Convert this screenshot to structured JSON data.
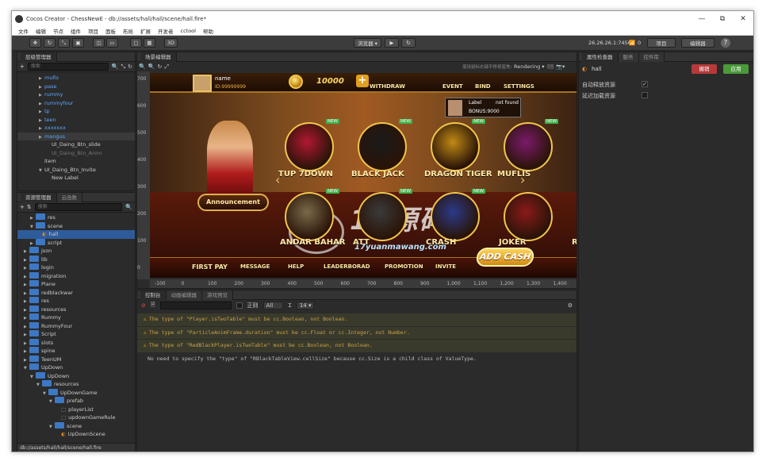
{
  "window": {
    "app": "Cocos Creator",
    "title": "Cocos Creator - ChessNewE - db://assets/hall/hall/scene/hall.fire*"
  },
  "window_controls": {
    "minimize": "—",
    "maximize": "⧉",
    "close": "✕"
  },
  "menu": [
    "文件",
    "编辑",
    "节点",
    "组件",
    "项目",
    "面板",
    "布局",
    "扩展",
    "开发者",
    "cctool",
    "帮助"
  ],
  "toolbar": {
    "btn_3d": "3D",
    "preview_select": "浏览器 ▾",
    "play": "▶",
    "refresh": "↻",
    "ip": "26.26.26.1:7456",
    "wifi_count": "0",
    "project_btn": "项目",
    "editor_btn": "编辑器",
    "help": "?"
  },
  "hierarchy": {
    "tab": "层级管理器",
    "search_placeholder": "搜索",
    "items": [
      {
        "label": "mufis",
        "indent": 3,
        "color": "blue"
      },
      {
        "label": "pase",
        "indent": 3,
        "color": "blue"
      },
      {
        "label": "rummy",
        "indent": 3,
        "color": "blue"
      },
      {
        "label": "rummyfour",
        "indent": 3,
        "color": "blue"
      },
      {
        "label": "tp",
        "indent": 3,
        "color": "blue"
      },
      {
        "label": "teen",
        "indent": 3,
        "color": "blue"
      },
      {
        "label": "xxxxxxx",
        "indent": 3,
        "color": "blue"
      },
      {
        "label": "mangus",
        "indent": 3,
        "color": "blue",
        "selected_bg": true
      },
      {
        "label": "UI_Daing_Btn_slide",
        "indent": 4,
        "color": "white"
      },
      {
        "label": "UI_Daing_Btn_Anim",
        "indent": 4,
        "color": "dim"
      },
      {
        "label": "item",
        "indent": 3,
        "color": "white"
      },
      {
        "label": "UI_Daing_Btn_Invite",
        "indent": 3,
        "color": "white",
        "expanded": true
      },
      {
        "label": "New Label",
        "indent": 4,
        "color": "white"
      }
    ]
  },
  "assets": {
    "tab": "资源管理器",
    "tab2": "云函数",
    "search_placeholder": "搜索",
    "items": [
      {
        "label": "res",
        "indent": 2,
        "type": "folder"
      },
      {
        "label": "scene",
        "indent": 2,
        "type": "folder",
        "expanded": true
      },
      {
        "label": "hall",
        "indent": 3,
        "type": "scene",
        "selected": true
      },
      {
        "label": "script",
        "indent": 2,
        "type": "folder"
      },
      {
        "label": "json",
        "indent": 1,
        "type": "folder"
      },
      {
        "label": "lib",
        "indent": 1,
        "type": "folder"
      },
      {
        "label": "login",
        "indent": 1,
        "type": "folder"
      },
      {
        "label": "migration",
        "indent": 1,
        "type": "folder"
      },
      {
        "label": "Plane",
        "indent": 1,
        "type": "folder"
      },
      {
        "label": "redblackwar",
        "indent": 1,
        "type": "folder"
      },
      {
        "label": "res",
        "indent": 1,
        "type": "folder"
      },
      {
        "label": "resources",
        "indent": 1,
        "type": "folder"
      },
      {
        "label": "Rummy",
        "indent": 1,
        "type": "folder"
      },
      {
        "label": "RummyFour",
        "indent": 1,
        "type": "folder"
      },
      {
        "label": "Script",
        "indent": 1,
        "type": "folder"
      },
      {
        "label": "slots",
        "indent": 1,
        "type": "folder"
      },
      {
        "label": "spine",
        "indent": 1,
        "type": "folder"
      },
      {
        "label": "TeenUM",
        "indent": 1,
        "type": "folder"
      },
      {
        "label": "UpDown",
        "indent": 1,
        "type": "folder",
        "expanded": true
      },
      {
        "label": "UpDown",
        "indent": 2,
        "type": "folder",
        "expanded": true
      },
      {
        "label": "resources",
        "indent": 3,
        "type": "folder",
        "expanded": true
      },
      {
        "label": "UpDownGame",
        "indent": 4,
        "type": "folder",
        "expanded": true
      },
      {
        "label": "prefab",
        "indent": 5,
        "type": "folder",
        "expanded": true
      },
      {
        "label": "playerList",
        "indent": 6,
        "type": "prefab"
      },
      {
        "label": "updownGameRule",
        "indent": 6,
        "type": "prefab"
      },
      {
        "label": "scene",
        "indent": 5,
        "type": "folder",
        "expanded": true
      },
      {
        "label": "UpDownScene",
        "indent": 6,
        "type": "scene"
      },
      {
        "label": "spine",
        "indent": 5,
        "type": "folder"
      }
    ],
    "status_path": "db://assets/hall/hall/scene/hall.fire"
  },
  "scene_editor": {
    "tab": "场景编辑器",
    "hint": "使用鼠标右键平移视窗焦点，使用滚轮缩放视图",
    "rendering": "Rendering ▾",
    "ruler_y": [
      "700",
      "600",
      "500",
      "400",
      "300",
      "200",
      "100",
      "0"
    ],
    "ruler_x": [
      "-100",
      "0",
      "100",
      "200",
      "300",
      "400",
      "500",
      "600",
      "700",
      "800",
      "900",
      "1,000",
      "1,100",
      "1,200",
      "1,300",
      "1,400"
    ]
  },
  "game": {
    "player_name": "name",
    "player_id": "ID:99999999",
    "coins": "10000",
    "withdraw": "WITHDRAW",
    "event": "EVENT",
    "bind": "BIND",
    "settings": "SETTINGS",
    "label_text": "Label",
    "not_found": "not found",
    "bonus": "BONUS:9000",
    "announcement": "Announcement",
    "new_tag": "NEW",
    "games_row1": [
      "TUP 7DOWN",
      "BLACK JACK",
      "DRAGON TIGER",
      "MUFLIS"
    ],
    "games_row2": [
      "ANDAR BAHAR",
      "ATT",
      "CRASH",
      "JOKER",
      "RU"
    ],
    "bottom": [
      "FIRST PAY",
      "MESSAGE",
      "HELP",
      "LEADERBORAD",
      "PROMOTION",
      "INVITE"
    ],
    "add_cash": "ADD CASH",
    "watermark_big": "17源码网",
    "watermark_small": "17yuanmawang.com"
  },
  "console": {
    "tab": "控制台",
    "tab2": "动画编辑器",
    "tab3": "游戏预览",
    "regex": "正则",
    "level": "All",
    "font_size": "14 ▾",
    "lines": [
      {
        "type": "warn",
        "text": "The type of \"Player.isTwoTable\" must be cc.Boolean, not Boolean."
      },
      {
        "type": "warn",
        "text": "The type of \"ParticleAnimFrame.duration\" must be cc.Float or cc.Integer, not Number."
      },
      {
        "type": "warn",
        "text": "The type of \"RedBlackPlayer.isTwoTable\" must be cc.Boolean, not Boolean."
      },
      {
        "type": "log",
        "text": "No need to specify the \"type\" of \"RBlackTableView.cellSize\" because cc.Size is a child class of ValueType."
      }
    ]
  },
  "inspector": {
    "tab": "属性检查器",
    "tab2": "服务",
    "tab3": "控件库",
    "node_name": "hall",
    "revert": "撤销",
    "apply": "应用",
    "auto_release": "自动释放资源",
    "auto_release_checked": true,
    "delay_load": "延迟加载资源",
    "delay_load_checked": false
  }
}
